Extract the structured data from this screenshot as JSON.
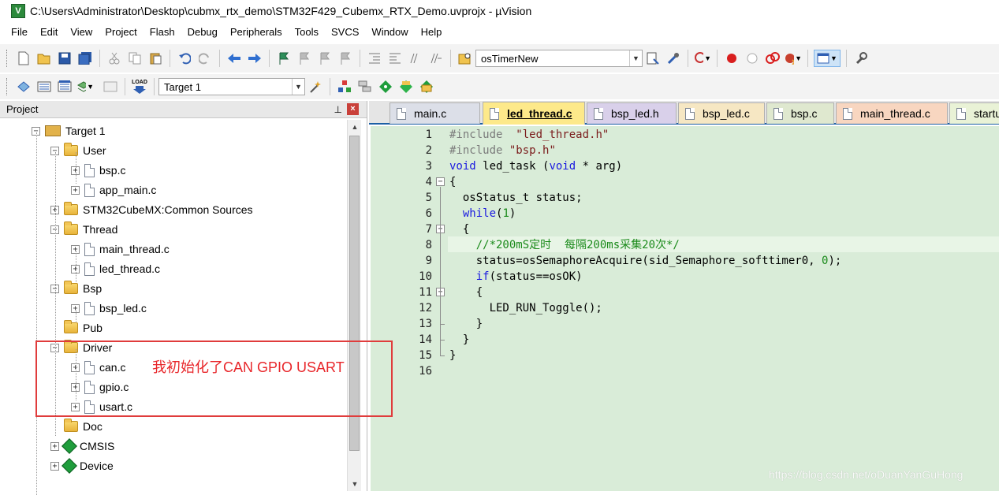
{
  "window": {
    "title": "C:\\Users\\Administrator\\Desktop\\cubmx_rtx_demo\\STM32F429_Cubemx_RTX_Demo.uvprojx - µVision"
  },
  "menu": [
    "File",
    "Edit",
    "View",
    "Project",
    "Flash",
    "Debug",
    "Peripherals",
    "Tools",
    "SVCS",
    "Window",
    "Help"
  ],
  "toolbar": {
    "find_value": "osTimerNew",
    "target_value": "Target 1",
    "load_label": "LOAD"
  },
  "project_panel": {
    "title": "Project",
    "pin_glyph": "ꟷ",
    "close_glyph": "×",
    "tree": [
      {
        "label": "Target 1",
        "expander": "−",
        "icon": "target-icon"
      },
      {
        "label": "User",
        "expander": "−",
        "icon": "folder-icon"
      },
      {
        "label": "bsp.c",
        "expander": "+",
        "icon": "file-icon"
      },
      {
        "label": "app_main.c",
        "expander": "+",
        "icon": "file-icon"
      },
      {
        "label": "STM32CubeMX:Common Sources",
        "expander": "+",
        "icon": "folder-icon"
      },
      {
        "label": "Thread",
        "expander": "−",
        "icon": "folder-icon"
      },
      {
        "label": "main_thread.c",
        "expander": "+",
        "icon": "file-icon"
      },
      {
        "label": "led_thread.c",
        "expander": "+",
        "icon": "file-icon"
      },
      {
        "label": "Bsp",
        "expander": "−",
        "icon": "folder-icon"
      },
      {
        "label": "bsp_led.c",
        "expander": "+",
        "icon": "file-icon"
      },
      {
        "label": "Pub",
        "expander": "",
        "icon": "folder-icon"
      },
      {
        "label": "Driver",
        "expander": "−",
        "icon": "folder-icon"
      },
      {
        "label": "can.c",
        "expander": "+",
        "icon": "file-icon"
      },
      {
        "label": "gpio.c",
        "expander": "+",
        "icon": "file-icon"
      },
      {
        "label": "usart.c",
        "expander": "+",
        "icon": "file-icon"
      },
      {
        "label": "Doc",
        "expander": "",
        "icon": "folder-icon"
      },
      {
        "label": "CMSIS",
        "expander": "+",
        "icon": "component-icon"
      },
      {
        "label": "Device",
        "expander": "+",
        "icon": "component-icon"
      }
    ]
  },
  "annotation": {
    "text": "我初始化了CAN GPIO USART",
    "color": "#e8262a"
  },
  "tabs": [
    {
      "label": "main.c",
      "color": "#dcdfe8"
    },
    {
      "label": "led_thread.c",
      "color": "#fde98a"
    },
    {
      "label": "bsp_led.h",
      "color": "#d9d0ea"
    },
    {
      "label": "bsp_led.c",
      "color": "#f6e7c3"
    },
    {
      "label": "bsp.c",
      "color": "#dfe8cf"
    },
    {
      "label": "main_thread.c",
      "color": "#f8d6c0"
    },
    {
      "label": "startup_",
      "color": "#e9f2d6"
    }
  ],
  "editor": {
    "active_tab": "led_thread.c",
    "lines": [
      {
        "n": "1",
        "html": "<span class=\"kw-pre\">#include</span>  <span class=\"str\">\"led_thread.h\"</span>"
      },
      {
        "n": "2",
        "html": "<span class=\"kw-pre\">#include</span> <span class=\"str\">\"bsp.h\"</span>"
      },
      {
        "n": "3",
        "html": "<span class=\"kw\">void</span> led_task (<span class=\"kw\">void</span> * arg)"
      },
      {
        "n": "4",
        "html": "{"
      },
      {
        "n": "5",
        "html": "  osStatus_t status;"
      },
      {
        "n": "6",
        "html": "  <span class=\"kw\">while</span>(<span class=\"num\">1</span>)"
      },
      {
        "n": "7",
        "html": "  {"
      },
      {
        "n": "8",
        "html": "    <span class=\"cmt\">//*200mS定时  每隔200ms采集20次*/</span>"
      },
      {
        "n": "9",
        "html": "    status=osSemaphoreAcquire(sid_Semaphore_softtimer0, <span class=\"num\">0</span>);"
      },
      {
        "n": "10",
        "html": "    <span class=\"kw\">if</span>(status==osOK)"
      },
      {
        "n": "11",
        "html": "    {"
      },
      {
        "n": "12",
        "html": "      LED_RUN_Toggle();"
      },
      {
        "n": "13",
        "html": "    }"
      },
      {
        "n": "14",
        "html": "  }"
      },
      {
        "n": "15",
        "html": "}"
      },
      {
        "n": "16",
        "html": ""
      }
    ]
  },
  "watermark": "https://blog.csdn.net/oDuanYanGuHong"
}
